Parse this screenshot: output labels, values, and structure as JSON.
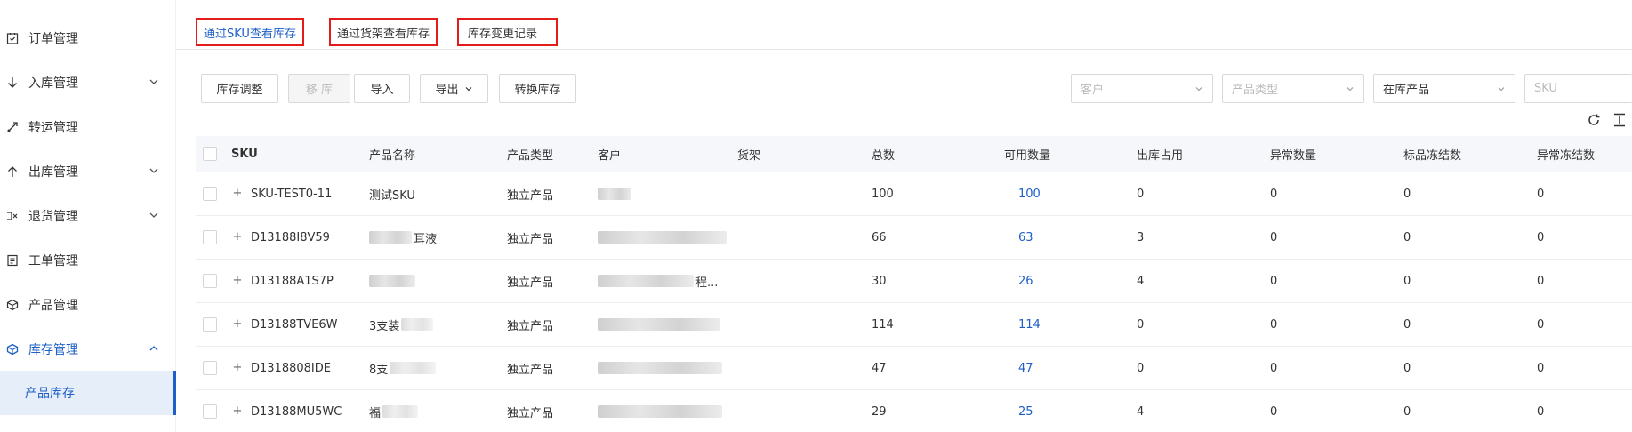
{
  "sidebar": {
    "items": [
      {
        "label": "订单管理",
        "icon": "order-icon"
      },
      {
        "label": "入库管理",
        "icon": "inbound-icon"
      },
      {
        "label": "转运管理",
        "icon": "transfer-icon"
      },
      {
        "label": "出库管理",
        "icon": "outbound-icon"
      },
      {
        "label": "退货管理",
        "icon": "return-icon"
      },
      {
        "label": "工单管理",
        "icon": "workorder-icon"
      },
      {
        "label": "产品管理",
        "icon": "product-icon"
      },
      {
        "label": "库存管理",
        "icon": "inventory-icon"
      }
    ],
    "sub_item": "产品库存"
  },
  "tabs": [
    {
      "label": "通过SKU查看库存"
    },
    {
      "label": "通过货架查看库存"
    },
    {
      "label": "库存变更记录"
    }
  ],
  "toolbar": {
    "adjust": "库存调整",
    "move": "移 库",
    "import": "导入",
    "export": "导出",
    "convert": "转换库存"
  },
  "filters": {
    "customer": "客户",
    "product_type": "产品类型",
    "stock_status": "在库产品",
    "sku": "SKU"
  },
  "table": {
    "headers": [
      "SKU",
      "产品名称",
      "产品类型",
      "客户",
      "货架",
      "总数",
      "可用数量",
      "出库占用",
      "异常数量",
      "标品冻结数",
      "异常冻结数"
    ],
    "rows": [
      {
        "sku": "SKU-TEST0-11",
        "name": "测试SKU",
        "type": "独立产品",
        "customer": "",
        "shelf": "",
        "total": "100",
        "available": "100",
        "outbound": "0",
        "abnormal": "0",
        "frozen_std": "0",
        "frozen_abn": "0"
      },
      {
        "sku": "D13188I8V59",
        "name": "耳液",
        "type": "独立产品",
        "customer": "",
        "shelf": "",
        "total": "66",
        "available": "63",
        "outbound": "3",
        "abnormal": "0",
        "frozen_std": "0",
        "frozen_abn": "0"
      },
      {
        "sku": "D13188A1S7P",
        "name": "",
        "type": "独立产品",
        "customer": "程...",
        "shelf": "",
        "total": "30",
        "available": "26",
        "outbound": "4",
        "abnormal": "0",
        "frozen_std": "0",
        "frozen_abn": "0"
      },
      {
        "sku": "D13188TVE6W",
        "name": "3支装",
        "type": "独立产品",
        "customer": "",
        "shelf": "",
        "total": "114",
        "available": "114",
        "outbound": "0",
        "abnormal": "0",
        "frozen_std": "0",
        "frozen_abn": "0"
      },
      {
        "sku": "D1318808IDE",
        "name": "8支",
        "type": "独立产品",
        "customer": "",
        "shelf": "",
        "total": "47",
        "available": "47",
        "outbound": "0",
        "abnormal": "0",
        "frozen_std": "0",
        "frozen_abn": "0"
      },
      {
        "sku": "D13188MU5WC",
        "name": "福",
        "type": "独立产品",
        "customer": "",
        "shelf": "",
        "total": "29",
        "available": "25",
        "outbound": "4",
        "abnormal": "0",
        "frozen_std": "0",
        "frozen_abn": "0"
      }
    ]
  },
  "colors": {
    "accent": "#1d5fc6",
    "highlight_border": "#e21b1b"
  }
}
